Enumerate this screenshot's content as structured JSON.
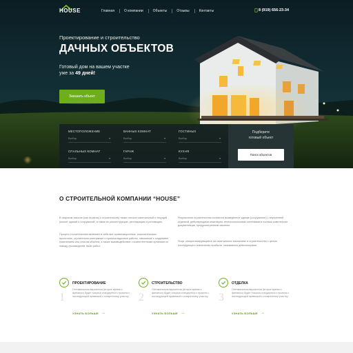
{
  "header": {
    "logo_text": "HOUSE",
    "nav": [
      "Главная",
      "О компании",
      "Объекты",
      "Отзывы",
      "Контакты"
    ],
    "phone": "8 (919) 656-23-34"
  },
  "hero": {
    "subtitle": "Проектирование и строительство",
    "title": "ДАЧНЫХ ОБЪЕКТОВ",
    "line1": "Готовый дом на вашем участке",
    "line2_prefix": "уже за",
    "line2_bold": "49 дней!",
    "order_button": "Заказать объект"
  },
  "filter": {
    "fields": [
      {
        "label": "МЕСТОПОЛОЖЕНИЕ",
        "value": "Выбор"
      },
      {
        "label": "ВАННЫХ КОМНАТ",
        "value": "Выбор"
      },
      {
        "label": "ГОСТИНЫХ",
        "value": "Выбор"
      },
      {
        "label": "СПАЛЬНЫХ КОМНАТ",
        "value": "Выбор"
      },
      {
        "label": "ГАРАЖ",
        "value": "Выбор"
      },
      {
        "label": "КУХНЯ",
        "value": "Выбор"
      }
    ],
    "side_line1": "Подберите",
    "side_line2": "готовый объект",
    "search_button": "Поиск объектов"
  },
  "about": {
    "title": "О СТРОИТЕЛЬНОЙ КОМПАНИИ “HOUSE”",
    "col1_p1": "В широком смысле (как отрасль) к строительству также относят капитальный и текущий ремонт зданий и сооружений, а также их реконструкцию, реставрацию и реновацию.",
    "col1_p2": "Процесс строительства включает в себя все организационные, изыскательские, проектные, строительно-монтажные и пусконаладочные работы, связанные с созданием, изменением или сносом объекта, а также взаимодействие с компетентными органами по поводу производства таких работ.",
    "col2_p1": "Результатом строительства считается возведённое здание (сооружение) с внутренней отделкой, действующими инженерно-технологическими системами и полным комплектом документации, предусмотренным законом.",
    "col2_p2": "Лица, специализирующиеся на капитальных вложениях в строительство с целью последующего извлечения прибыли, называются девелоперами."
  },
  "stages": [
    {
      "title": "ПРОЕКТИРОВАНИЕ",
      "num": "1",
      "text": "Оптимальным вариантом (второе время и финансы) будет покупка стандартного проекта с последующей привязкой к конкретному участку.",
      "more": "УЗНАТЬ БОЛЬШЕ"
    },
    {
      "title": "СТРОИТЕЛЬСТВО",
      "num": "2",
      "text": "Оптимальным вариантом (второе время и финансы) будет покупка стандартного проекта с последующей привязкой к конкретному участку.",
      "more": "УЗНАТЬ БОЛЬШЕ"
    },
    {
      "title": "ОТДЕЛКА",
      "num": "3",
      "text": "Оптимальным вариантом (второе время и финансы) будет покупка стандартного проекта с последующей привязкой к конкретному участку.",
      "more": "УЗНАТЬ БОЛЬШЕ"
    }
  ],
  "colors": {
    "accent": "#6fae1b",
    "hero_bg": "#112b32",
    "filter_bg": "#142022"
  },
  "icons": [
    "house-logo-icon",
    "phone-icon",
    "check-icon",
    "chevron-down-icon",
    "arrow-right-icon"
  ]
}
